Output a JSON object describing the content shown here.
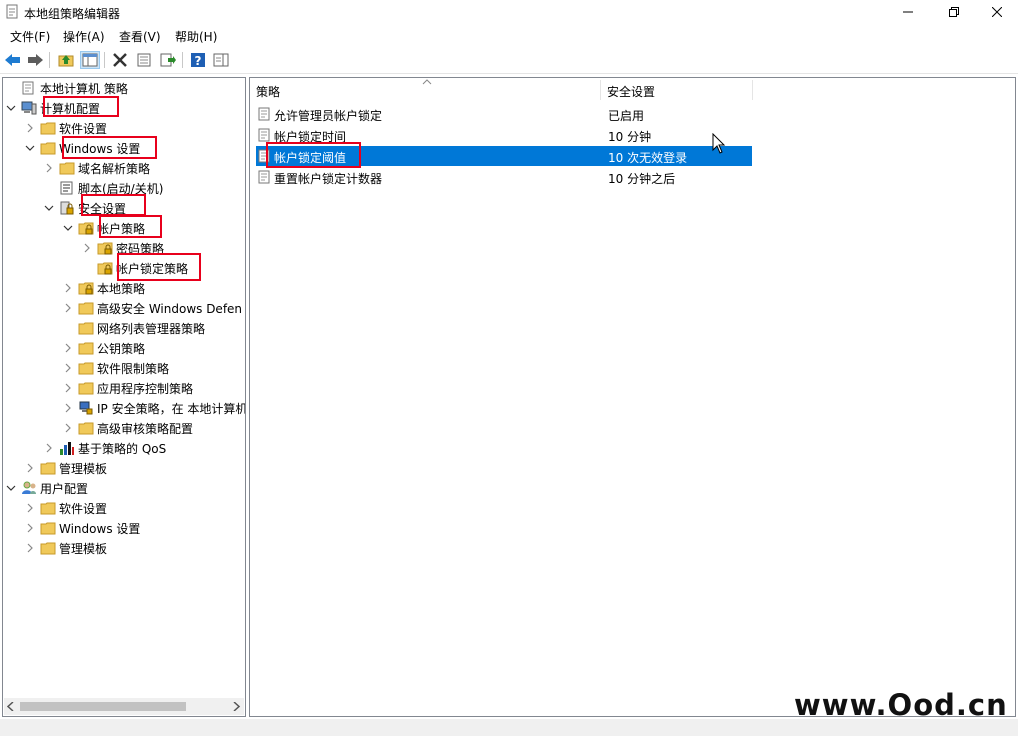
{
  "window": {
    "title": "本地组策略编辑器"
  },
  "menu": [
    "文件(F)",
    "操作(A)",
    "查看(V)",
    "帮助(H)"
  ],
  "tree": [
    {
      "label": "本地计算机 策略",
      "level": 0,
      "chevron": "none",
      "icon": "policy-doc-icon"
    },
    {
      "label": "计算机配置",
      "level": 0,
      "chevron": "down",
      "icon": "computer-icon"
    },
    {
      "label": "软件设置",
      "level": 1,
      "chevron": "right",
      "icon": "folder-icon"
    },
    {
      "label": "Windows 设置",
      "level": 1,
      "chevron": "down",
      "icon": "folder-icon"
    },
    {
      "label": "域名解析策略",
      "level": 2,
      "chevron": "right",
      "icon": "folder-icon"
    },
    {
      "label": "脚本(启动/关机)",
      "level": 2,
      "chevron": "none",
      "icon": "script-icon"
    },
    {
      "label": "安全设置",
      "level": 2,
      "chevron": "down",
      "icon": "security-icon"
    },
    {
      "label": "帐户策略",
      "level": 3,
      "chevron": "down",
      "icon": "folder-lock-icon"
    },
    {
      "label": "密码策略",
      "level": 4,
      "chevron": "right",
      "icon": "folder-lock-icon"
    },
    {
      "label": "帐户锁定策略",
      "level": 4,
      "chevron": "none",
      "icon": "folder-lock-icon"
    },
    {
      "label": "本地策略",
      "level": 3,
      "chevron": "right",
      "icon": "folder-lock-icon"
    },
    {
      "label": "高级安全 Windows Defen",
      "level": 3,
      "chevron": "right",
      "icon": "folder-icon"
    },
    {
      "label": "网络列表管理器策略",
      "level": 3,
      "chevron": "none",
      "icon": "folder-icon"
    },
    {
      "label": "公钥策略",
      "level": 3,
      "chevron": "right",
      "icon": "folder-icon"
    },
    {
      "label": "软件限制策略",
      "level": 3,
      "chevron": "right",
      "icon": "folder-icon"
    },
    {
      "label": "应用程序控制策略",
      "level": 3,
      "chevron": "right",
      "icon": "folder-icon"
    },
    {
      "label": "IP 安全策略，在 本地计算机",
      "level": 3,
      "chevron": "right",
      "icon": "ip-security-icon"
    },
    {
      "label": "高级审核策略配置",
      "level": 3,
      "chevron": "right",
      "icon": "folder-icon"
    },
    {
      "label": "基于策略的 QoS",
      "level": 2,
      "chevron": "right",
      "icon": "qos-chart-icon"
    },
    {
      "label": "管理模板",
      "level": 1,
      "chevron": "right",
      "icon": "folder-icon"
    },
    {
      "label": "用户配置",
      "level": 0,
      "chevron": "down",
      "icon": "user-icon"
    },
    {
      "label": "软件设置",
      "level": 1,
      "chevron": "right",
      "icon": "folder-icon"
    },
    {
      "label": "Windows 设置",
      "level": 1,
      "chevron": "right",
      "icon": "folder-icon"
    },
    {
      "label": "管理模板",
      "level": 1,
      "chevron": "right",
      "icon": "folder-icon"
    }
  ],
  "list": {
    "columns": [
      "策略",
      "安全设置"
    ],
    "rows": [
      {
        "policy": "允许管理员帐户锁定",
        "setting": "已启用",
        "selected": false
      },
      {
        "policy": "帐户锁定时间",
        "setting": "10 分钟",
        "selected": false
      },
      {
        "policy": "帐户锁定阈值",
        "setting": "10 次无效登录",
        "selected": true
      },
      {
        "policy": "重置帐户锁定计数器",
        "setting": "10 分钟之后",
        "selected": false
      }
    ]
  },
  "watermark": "www.Ood.cn",
  "colors": {
    "selection": "#0078d7",
    "highlight_box": "#e8001c",
    "folder": "#f0c95a"
  }
}
